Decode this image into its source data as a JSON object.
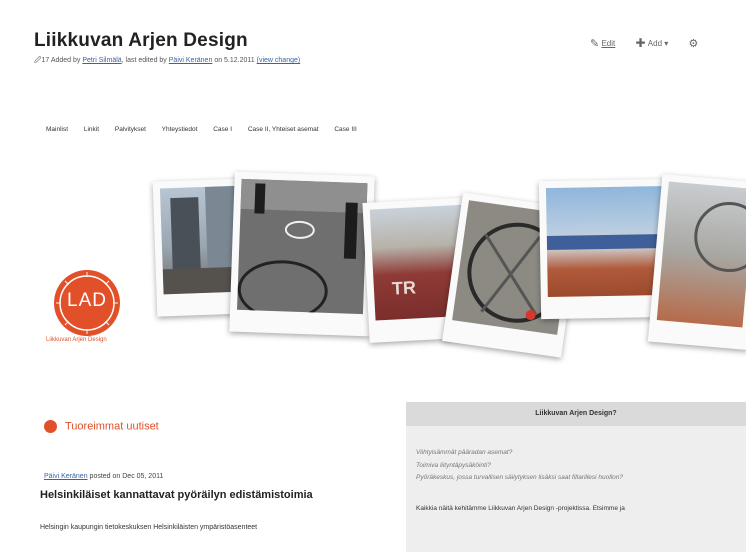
{
  "header": {
    "title": "Liikkuvan Arjen Design",
    "meta": {
      "version": "17",
      "added_by": "Added by",
      "author": "Petri Silmälä",
      "edited": ", last edited by",
      "editor": "Päivi Keränen",
      "date": "on 5.12.2011",
      "view_change": "(view change)"
    },
    "actions": {
      "edit": "Edit",
      "add": "Add"
    }
  },
  "nav": {
    "items": [
      "Mainlist",
      "Linkit",
      "Palvitykset",
      "Yhteystiedot",
      "Case I",
      "Case II, Yhteiset asemat",
      "Case III"
    ]
  },
  "logo": {
    "mark": "LAD",
    "caption": "Liikkuvan Arjen Design"
  },
  "news": {
    "heading": "Tuoreimmat uutiset",
    "post": {
      "author": "Päivi Keränen",
      "posted_on": "posted on Dec 05, 2011",
      "title": "Helsinkiläiset kannattavat pyöräilyn edistämistoimia",
      "body": "Helsingin kaupungin tietokeskuksen Helsinkiläisten ympäristöasenteet"
    }
  },
  "sidebar": {
    "heading": "Liikkuvan Arjen Design?",
    "questions": [
      "Viihtyisämmät pääradan asemat?",
      "Toimiva liityntäpysäköinti?",
      "Pyöräkeskus, jossa turvallisen säilytyksen lisäksi saat fillarillesi huollon?"
    ],
    "body": "Kaikkia näitä kehitämme Liikkuvan Arjen Design -projektissa. Etsimme ja"
  },
  "colors": {
    "accent": "#e2502a",
    "link": "#3a62a8",
    "sidebar_bg": "#eeeeee"
  }
}
